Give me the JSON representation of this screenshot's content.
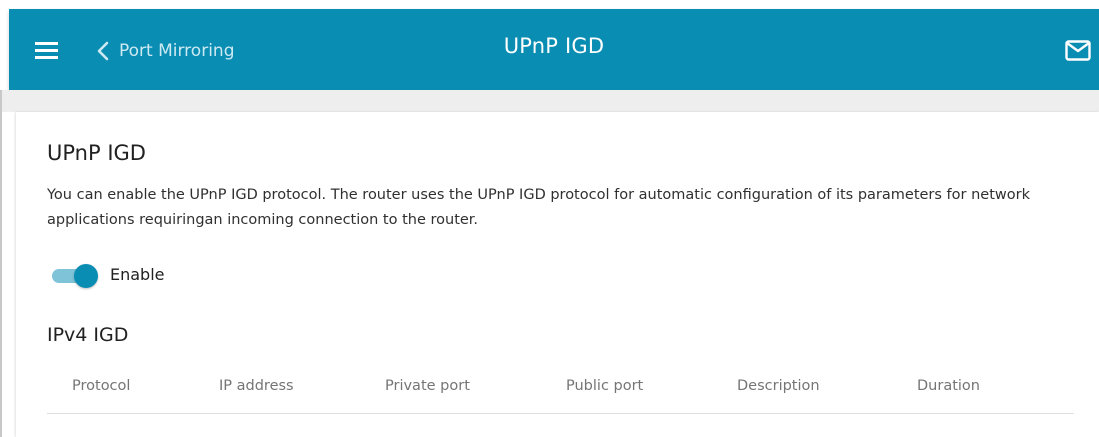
{
  "header": {
    "back_label": "Port Mirroring",
    "title": "UPnP IGD",
    "icons": {
      "menu": "hamburger-menu-icon",
      "back": "chevron-left-icon",
      "mail": "mail-icon"
    },
    "color": "#0a8db3"
  },
  "main": {
    "title": "UPnP IGD",
    "description": "You can enable the UPnP IGD protocol. The router uses the UPnP IGD protocol for automatic configuration of its parameters for network applications requiringan incoming connection to the router.",
    "enable_label": "Enable",
    "enable_state": true,
    "ipv4": {
      "title": "IPv4 IGD",
      "columns": [
        "Protocol",
        "IP address",
        "Private port",
        "Public port",
        "Description",
        "Duration"
      ],
      "rows": []
    }
  }
}
